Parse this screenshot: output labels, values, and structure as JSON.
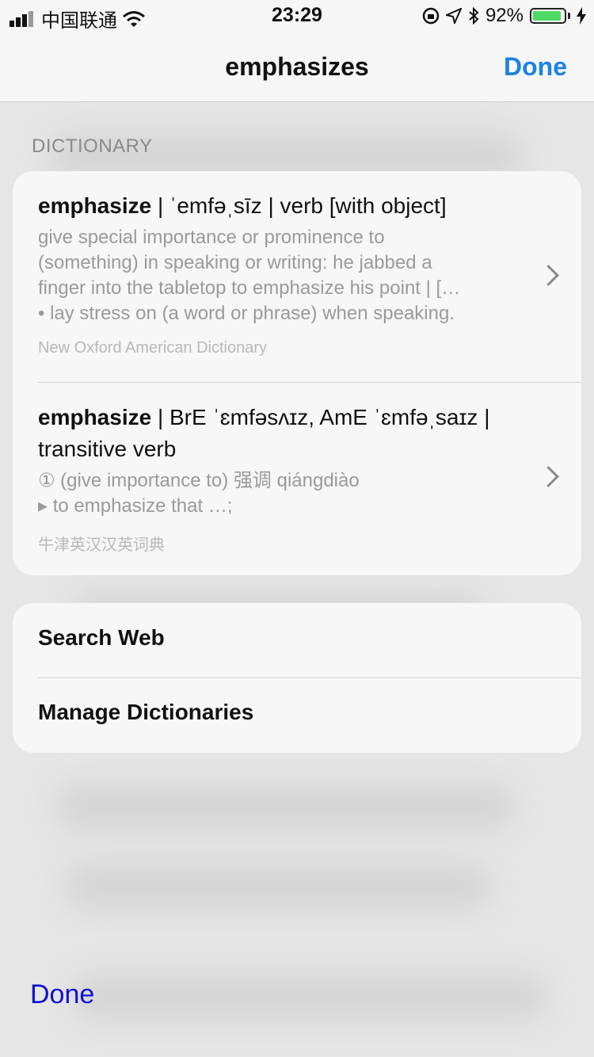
{
  "status_bar": {
    "carrier": "中国联通",
    "time": "23:29",
    "battery_percent": "92%",
    "battery_level": 0.92,
    "icons": [
      "signal-icon",
      "wifi-icon",
      "orientation-lock-icon",
      "location-icon",
      "bluetooth-icon",
      "battery-icon",
      "charging-icon"
    ]
  },
  "nav": {
    "title": "emphasizes",
    "done_label": "Done"
  },
  "section_header": "DICTIONARY",
  "entries": [
    {
      "word": "emphasize",
      "pron": " | ˈemfəˌsīz | verb [with object]",
      "definition_lines": [
        "give special importance or prominence to",
        "(something) in speaking or writing: he jabbed a",
        "finger into the tabletop to emphasize his point | […",
        "• lay stress on (a word or phrase) when speaking."
      ],
      "source": "New Oxford American Dictionary"
    },
    {
      "word": "emphasize",
      "pron": " | BrE ˈɛmfəsʌɪz, AmE ˈɛmfəˌsaɪz |",
      "pron_line2": "transitive verb",
      "definition_lines": [
        "① (give importance to) 强调 qiángdiào",
        "▸ to emphasize that …;"
      ],
      "source": "牛津英汉汉英词典"
    }
  ],
  "actions": {
    "search_web": "Search Web",
    "manage_dictionaries": "Manage Dictionaries"
  },
  "bottom": {
    "done_label": "Done"
  },
  "colors": {
    "accent": "#1a82e6",
    "bottom_done": "#1010d0",
    "battery": "#4cd964"
  }
}
